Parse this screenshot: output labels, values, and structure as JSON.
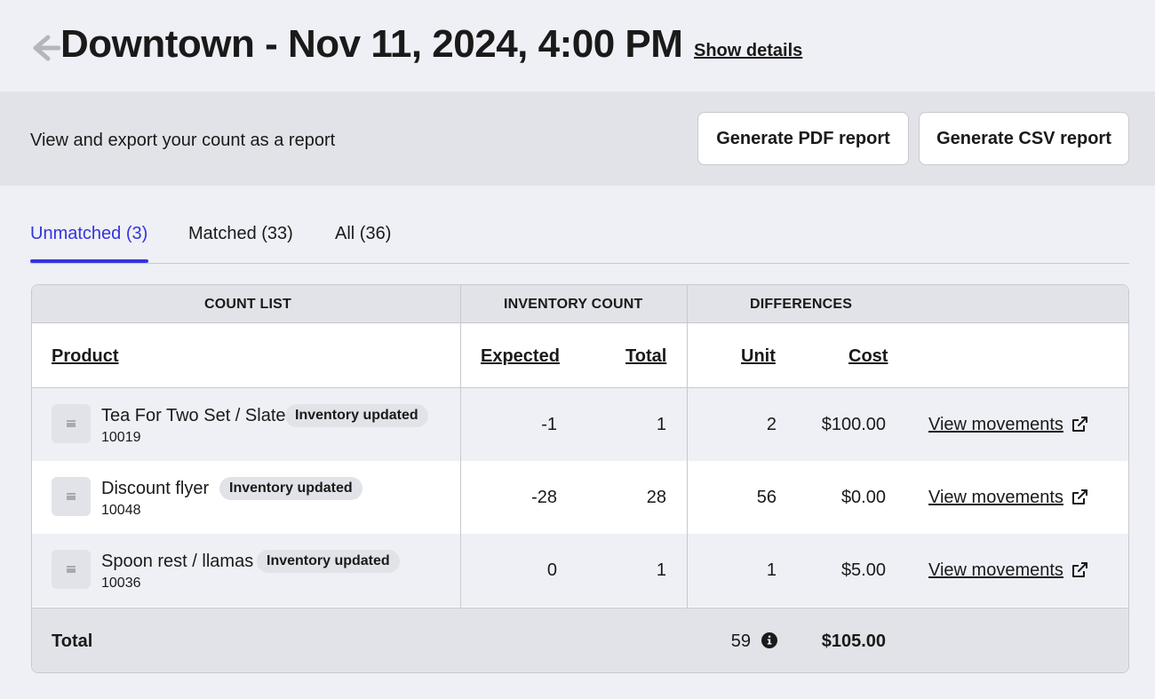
{
  "header": {
    "title": "Downtown - Nov 11, 2024, 4:00 PM",
    "show_details": "Show details"
  },
  "report": {
    "description": "View and export your count as a report",
    "pdf_button": "Generate PDF report",
    "csv_button": "Generate CSV report"
  },
  "tabs": [
    {
      "label": "Unmatched (3)",
      "active": true
    },
    {
      "label": "Matched (33)",
      "active": false
    },
    {
      "label": "All (36)",
      "active": false
    }
  ],
  "table": {
    "groups": [
      "COUNT LIST",
      "INVENTORY COUNT",
      "DIFFERENCES"
    ],
    "columns": {
      "product": "Product",
      "expected": "Expected",
      "total": "Total",
      "unit": "Unit",
      "cost": "Cost"
    },
    "rows": [
      {
        "name": "Tea For Two Set / Slate",
        "badge": "Inventory updated",
        "sku": "10019",
        "expected": "-1",
        "total": "1",
        "unit": "2",
        "cost": "$100.00",
        "link": "View movements"
      },
      {
        "name": "Discount flyer",
        "badge": "Inventory updated",
        "sku": "10048",
        "expected": "-28",
        "total": "28",
        "unit": "56",
        "cost": "$0.00",
        "link": "View movements"
      },
      {
        "name": "Spoon rest / llamas",
        "badge": "Inventory updated",
        "sku": "10036",
        "expected": "0",
        "total": "1",
        "unit": "1",
        "cost": "$5.00",
        "link": "View movements"
      }
    ],
    "footer": {
      "label": "Total",
      "units": "59",
      "cost": "$105.00"
    }
  },
  "colors": {
    "accent": "#3434e0",
    "page_bg": "#eff0f5",
    "band_bg": "#e2e3e8"
  },
  "icons": {
    "back": "arrow-left-icon",
    "thumb": "image-placeholder-icon",
    "external": "external-link-icon",
    "info": "info-circle-icon"
  }
}
